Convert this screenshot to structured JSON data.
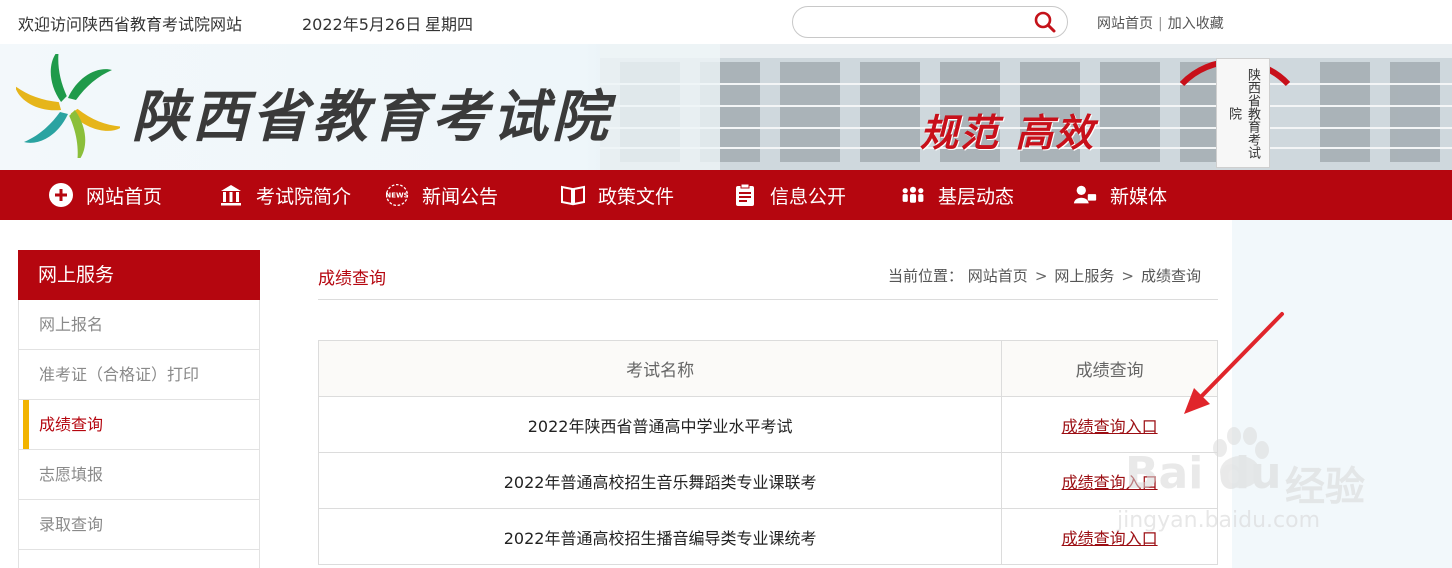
{
  "topbar": {
    "welcome": "欢迎访问陕西省教育考试院网站",
    "date": "2022年5月26日",
    "weekday": "星期四",
    "search_placeholder": "",
    "links": {
      "home": "网站首页",
      "favorite": "加入收藏"
    },
    "separator": "|"
  },
  "banner": {
    "site_name": "陕西省教育考试院",
    "slogan": "规范 高效",
    "plaque_text": "陕西省教育考试院"
  },
  "nav": {
    "items": [
      {
        "label": "网站首页",
        "icon": "home-icon"
      },
      {
        "label": "考试院简介",
        "icon": "building-icon"
      },
      {
        "label": "新闻公告",
        "icon": "news-icon",
        "icon_text": "NEWS"
      },
      {
        "label": "政策文件",
        "icon": "book-icon"
      },
      {
        "label": "信息公开",
        "icon": "clipboard-icon"
      },
      {
        "label": "基层动态",
        "icon": "people-icon"
      },
      {
        "label": "新媒体",
        "icon": "media-icon"
      }
    ]
  },
  "sidebar": {
    "title": "网上服务",
    "items": [
      {
        "label": "网上报名",
        "active": false
      },
      {
        "label": "准考证（合格证）打印",
        "active": false
      },
      {
        "label": "成绩查询",
        "active": true
      },
      {
        "label": "志愿填报",
        "active": false
      },
      {
        "label": "录取查询",
        "active": false
      }
    ]
  },
  "main": {
    "title": "成绩查询",
    "breadcrumb": {
      "prefix": "当前位置：",
      "items": [
        "网站首页",
        "网上服务",
        "成绩查询"
      ],
      "separator": ">"
    },
    "table": {
      "headers": [
        "考试名称",
        "成绩查询"
      ],
      "rows": [
        {
          "name": "2022年陕西省普通高中学业水平考试",
          "link": "成绩查询入口"
        },
        {
          "name": "2022年普通高校招生音乐舞蹈类专业课联考",
          "link": "成绩查询入口"
        },
        {
          "name": "2022年普通高校招生播音编导类专业课统考",
          "link": "成绩查询入口"
        }
      ]
    }
  },
  "watermark": {
    "brand": "Bai du",
    "cn": "经验",
    "url": "jingyan.baidu.com"
  },
  "colors": {
    "brand_red": "#b5060f",
    "active_marker": "#f2b400",
    "link_red": "#9b0d12",
    "annotation_arrow": "#e0252b"
  }
}
